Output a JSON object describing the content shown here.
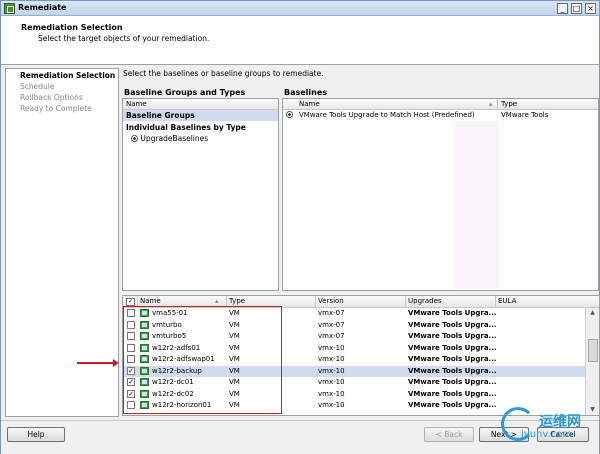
{
  "window": {
    "title": "Remediate"
  },
  "header": {
    "title": "Remediation Selection",
    "subtitle": "Select the target objects of your remediation."
  },
  "nav": {
    "items": [
      {
        "label": "Remediation Selection",
        "active": true
      },
      {
        "label": "Schedule",
        "active": false
      },
      {
        "label": "Rollback Options",
        "active": false
      },
      {
        "label": "Ready to Complete",
        "active": false
      }
    ]
  },
  "instruction": "Select the baselines or baseline groups to remediate.",
  "baseline_groups": {
    "title": "Baseline Groups and Types",
    "col_name": "Name",
    "selected_row": "Baseline Groups",
    "section": "Individual Baselines by Type",
    "option": "UpgradeBaselines"
  },
  "baselines": {
    "title": "Baselines",
    "col_name": "Name",
    "col_type": "Type",
    "rows": [
      {
        "name": "VMware Tools Upgrade to Match Host (Predefined)",
        "type": "VMware Tools"
      }
    ]
  },
  "grid": {
    "headers": {
      "name": "Name",
      "type": "Type",
      "version": "Version",
      "upgrades": "Upgrades",
      "eula": "EULA"
    },
    "rows": [
      {
        "name": "vma55-01",
        "type": "VM",
        "version": "vmx-07",
        "upgrades": "VMware Tools Upgra...",
        "checked": false,
        "selected": false
      },
      {
        "name": "vmturbo",
        "type": "VM",
        "version": "vmx-07",
        "upgrades": "VMware Tools Upgra...",
        "checked": false,
        "selected": false
      },
      {
        "name": "vmturbo5",
        "type": "VM",
        "version": "vmx-07",
        "upgrades": "VMware Tools Upgra...",
        "checked": false,
        "selected": false
      },
      {
        "name": "w12r2-adfs01",
        "type": "VM",
        "version": "vmx-10",
        "upgrades": "VMware Tools Upgra...",
        "checked": false,
        "selected": false
      },
      {
        "name": "w12r2-adfswap01",
        "type": "VM",
        "version": "vmx-10",
        "upgrades": "VMware Tools Upgra...",
        "checked": false,
        "selected": false
      },
      {
        "name": "w12r2-backup",
        "type": "VM",
        "version": "vmx-10",
        "upgrades": "VMware Tools Upgra...",
        "checked": true,
        "selected": true
      },
      {
        "name": "w12r2-dc01",
        "type": "VM",
        "version": "vmx-10",
        "upgrades": "VMware Tools Upgra...",
        "checked": true,
        "selected": false
      },
      {
        "name": "w12r2-dc02",
        "type": "VM",
        "version": "vmx-10",
        "upgrades": "VMware Tools Upgra...",
        "checked": true,
        "selected": false
      },
      {
        "name": "w12r2-horizon01",
        "type": "VM",
        "version": "vmx-10",
        "upgrades": "VMware Tools Upgra...",
        "checked": false,
        "selected": false
      }
    ]
  },
  "footer": {
    "help": "Help",
    "back": "< Back",
    "next": "Next >",
    "cancel": "Cancel"
  },
  "watermark": {
    "line1": "运维网",
    "line2": "iyunv.com"
  },
  "colors": {
    "selection": "#cfdcf0",
    "annotation": "#c0202a",
    "icon_green": "#4f9a43"
  }
}
